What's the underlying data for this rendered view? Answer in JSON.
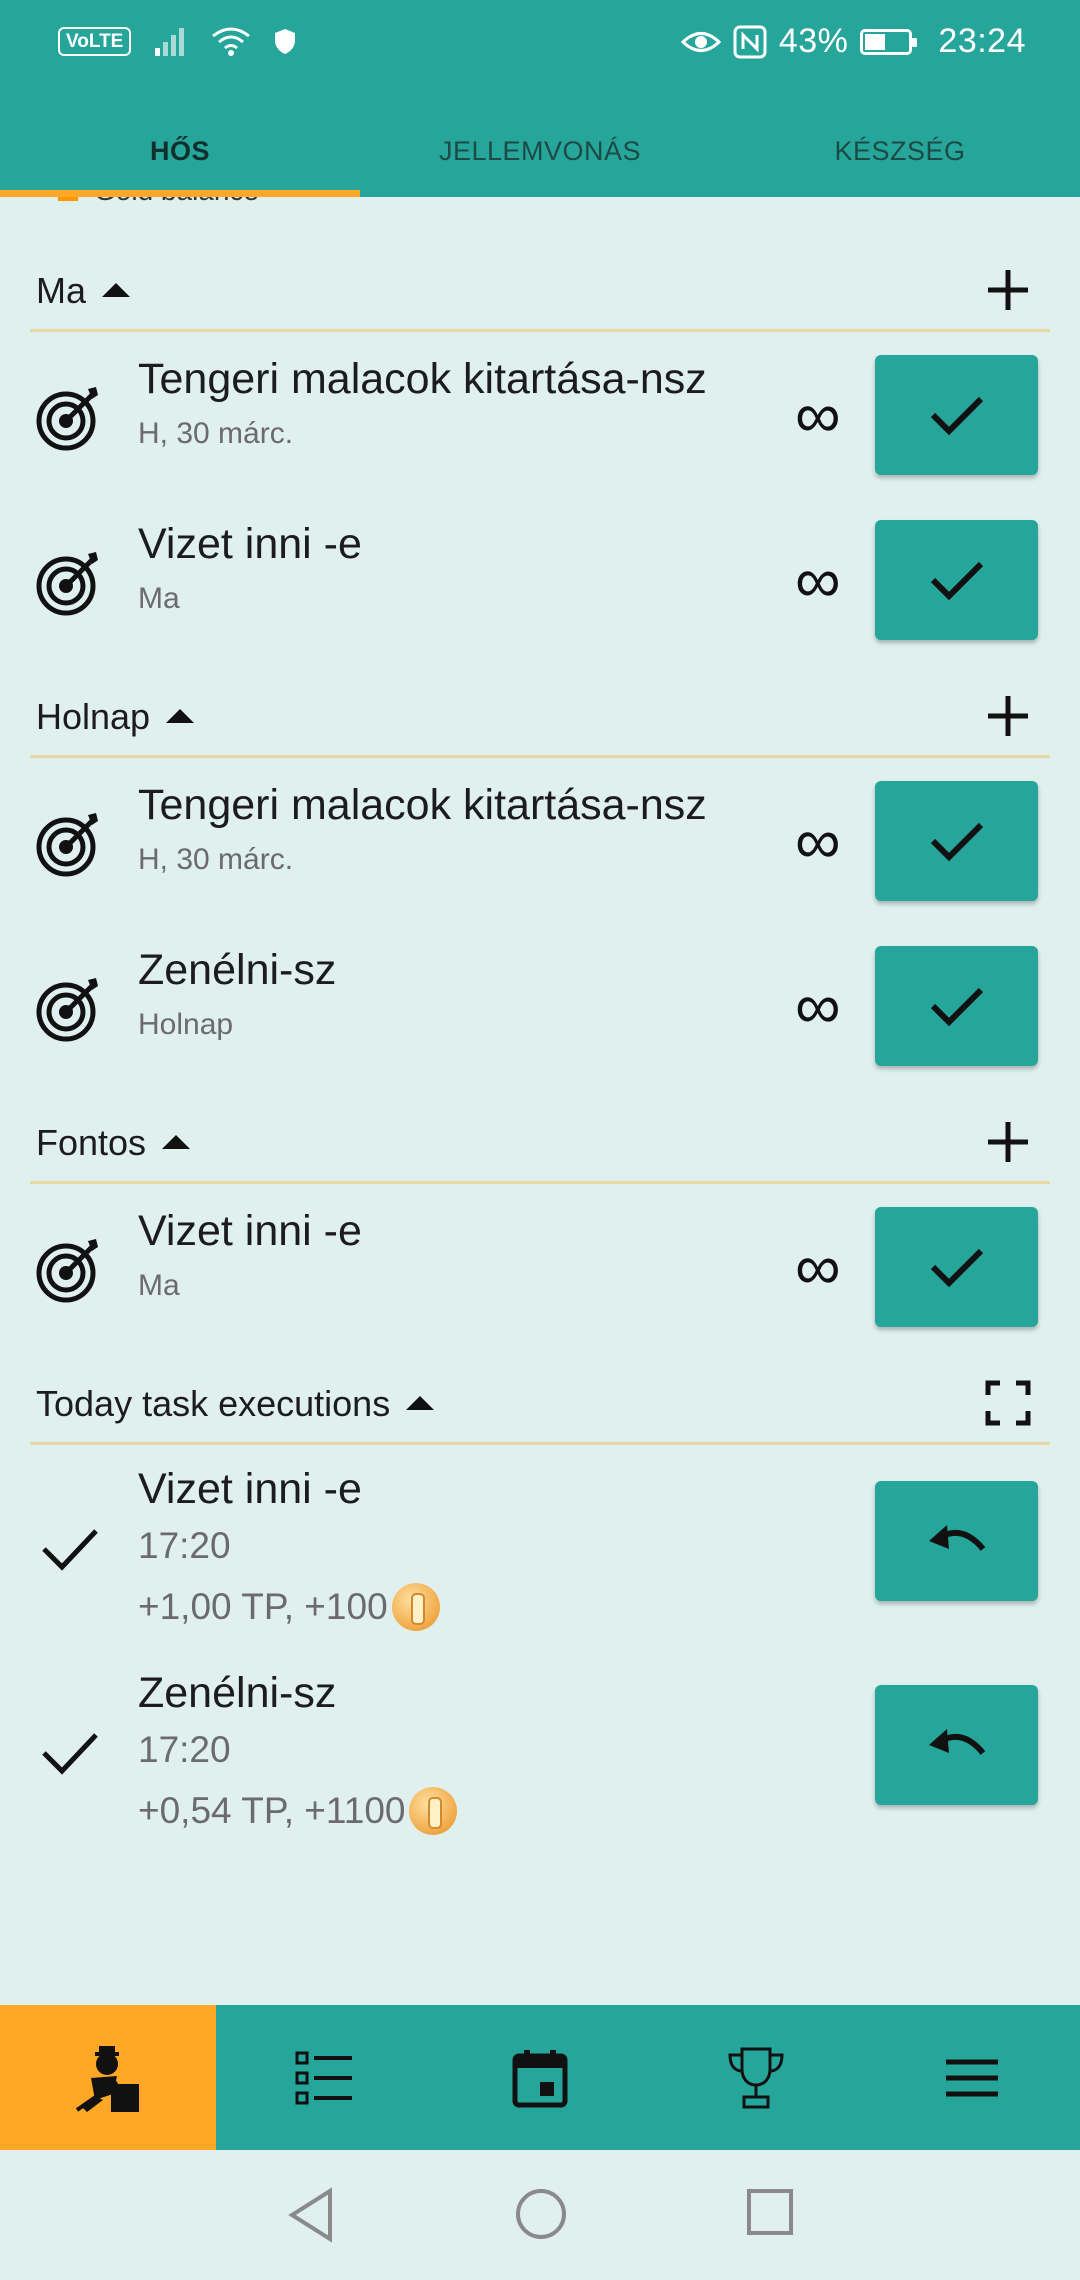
{
  "status_bar": {
    "volte": "VoLTE",
    "battery_text": "43%",
    "time": "23:24",
    "battery_level": 0.43
  },
  "tabs": [
    {
      "label": "HŐS",
      "active": true
    },
    {
      "label": "JELLEMVONÁS",
      "active": false
    },
    {
      "label": "KÉSZSÉG",
      "active": false
    }
  ],
  "peek_item": "Gold balance",
  "sections": {
    "today": {
      "title": "Ma",
      "tasks": [
        {
          "name": "Tengeri malacok kitartása-nsz",
          "date": "H, 30 márc.",
          "repeat": "∞"
        },
        {
          "name": "Vizet inni -e",
          "date": "Ma",
          "repeat": "∞"
        }
      ]
    },
    "tomorrow": {
      "title": "Holnap",
      "tasks": [
        {
          "name": "Tengeri malacok kitartása-nsz",
          "date": "H, 30 márc.",
          "repeat": "∞"
        },
        {
          "name": "Zenélni-sz",
          "date": "Holnap",
          "repeat": "∞"
        }
      ]
    },
    "important": {
      "title": "Fontos",
      "tasks": [
        {
          "name": "Vizet inni -e",
          "date": "Ma",
          "repeat": "∞"
        }
      ]
    },
    "executions": {
      "title": "Today task executions",
      "items": [
        {
          "name": "Vizet inni -e",
          "time": "17:20",
          "reward": "+1,00 TP, +100"
        },
        {
          "name": "Zenélni-sz",
          "time": "17:20",
          "reward": "+0,54 TP, +1100"
        }
      ]
    }
  },
  "bottom_nav": [
    {
      "icon": "hero-icon",
      "active": true
    },
    {
      "icon": "task-list-icon",
      "active": false
    },
    {
      "icon": "calendar-icon",
      "active": false
    },
    {
      "icon": "trophy-icon",
      "active": false
    },
    {
      "icon": "menu-icon",
      "active": false
    }
  ],
  "colors": {
    "primary": "#26a69a",
    "accent": "#ffa726",
    "background": "#dff0ef",
    "divider": "#e8d9a0"
  }
}
